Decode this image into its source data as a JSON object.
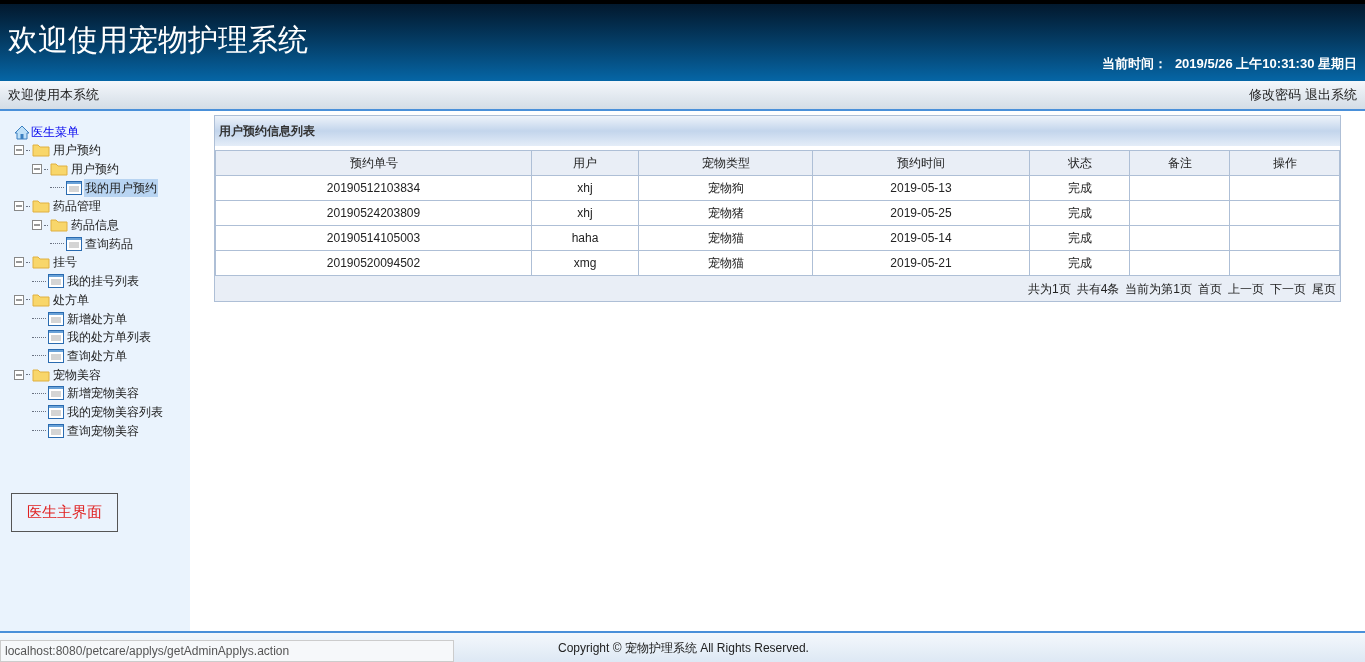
{
  "header": {
    "title": "欢迎使用宠物护理系统",
    "time_label": "当前时间：",
    "time_value": "2019/5/26 上午10:31:30 星期日"
  },
  "top_bar": {
    "welcome": "欢迎使用本系统",
    "links": [
      "修改密码",
      "退出系统"
    ]
  },
  "sidebar": {
    "root": "医生菜单",
    "tree": [
      {
        "label": "用户预约",
        "kind": "folder",
        "expanded": true,
        "selected": false,
        "children": [
          {
            "label": "用户预约",
            "kind": "folder",
            "expanded": true,
            "selected": false,
            "children": [
              {
                "label": "我的用户预约",
                "kind": "page",
                "selected": true
              }
            ]
          }
        ]
      },
      {
        "label": "药品管理",
        "kind": "folder",
        "expanded": true,
        "selected": false,
        "children": [
          {
            "label": "药品信息",
            "kind": "folder",
            "expanded": true,
            "selected": false,
            "children": [
              {
                "label": "查询药品",
                "kind": "page",
                "selected": false
              }
            ]
          }
        ]
      },
      {
        "label": "挂号",
        "kind": "folder",
        "expanded": true,
        "selected": false,
        "children": [
          {
            "label": "我的挂号列表",
            "kind": "page",
            "selected": false
          }
        ]
      },
      {
        "label": "处方单",
        "kind": "folder",
        "expanded": true,
        "selected": false,
        "children": [
          {
            "label": "新增处方单",
            "kind": "page",
            "selected": false
          },
          {
            "label": "我的处方单列表",
            "kind": "page",
            "selected": false
          },
          {
            "label": "查询处方单",
            "kind": "page",
            "selected": false
          }
        ]
      },
      {
        "label": "宠物美容",
        "kind": "folder",
        "expanded": true,
        "selected": false,
        "children": [
          {
            "label": "新增宠物美容",
            "kind": "page",
            "selected": false
          },
          {
            "label": "我的宠物美容列表",
            "kind": "page",
            "selected": false
          },
          {
            "label": "查询宠物美容",
            "kind": "page",
            "selected": false
          }
        ]
      }
    ],
    "home_button": "医生主界面"
  },
  "panel": {
    "title": "用户预约信息列表",
    "table": {
      "columns": [
        "预约单号",
        "用户",
        "宠物类型",
        "预约时间",
        "状态",
        "备注",
        "操作"
      ],
      "rows": [
        [
          "20190512103834",
          "xhj",
          "宠物狗",
          "2019-05-13",
          "完成",
          "",
          ""
        ],
        [
          "20190524203809",
          "xhj",
          "宠物猪",
          "2019-05-25",
          "完成",
          "",
          ""
        ],
        [
          "20190514105003",
          "haha",
          "宠物猫",
          "2019-05-14",
          "完成",
          "",
          ""
        ],
        [
          "20190520094502",
          "xmg",
          "宠物猫",
          "2019-05-21",
          "完成",
          "",
          ""
        ]
      ]
    },
    "pager": {
      "info": [
        "共为1页",
        "共有4条",
        "当前为第1页"
      ],
      "links": [
        "首页",
        "上一页",
        "下一页",
        "尾页"
      ]
    }
  },
  "status_url": "localhost:8080/petcare/applys/getAdminApplys.action",
  "footer": "Copyright © 宠物护理系统 All Rights Reserved."
}
